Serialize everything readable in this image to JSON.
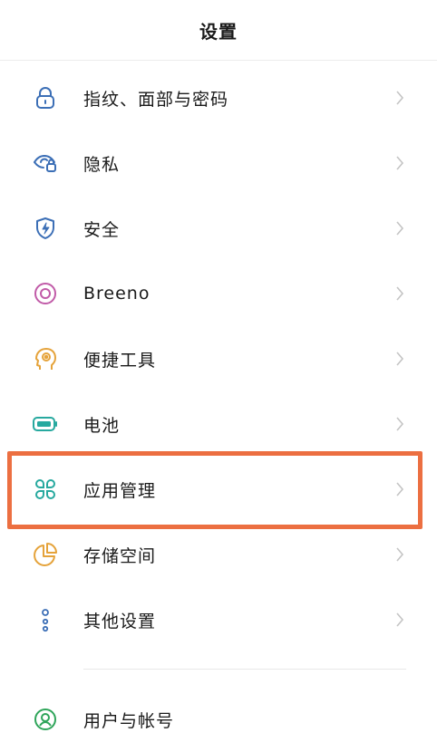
{
  "header": {
    "title": "设置"
  },
  "items": [
    {
      "label": "指纹、面部与密码",
      "icon": "lock-icon",
      "color": "#3c6fb6"
    },
    {
      "label": "隐私",
      "icon": "privacy-eye-icon",
      "color": "#3c6fb6"
    },
    {
      "label": "安全",
      "icon": "shield-icon",
      "color": "#3c6fb6"
    },
    {
      "label": "Breeno",
      "icon": "breeno-icon",
      "color": "#c15ba8"
    },
    {
      "label": "便捷工具",
      "icon": "head-gear-icon",
      "color": "#e5a33b"
    },
    {
      "label": "电池",
      "icon": "battery-icon",
      "color": "#27a99f"
    },
    {
      "label": "应用管理",
      "icon": "apps-grid-icon",
      "color": "#27a99f"
    },
    {
      "label": "存储空间",
      "icon": "pie-chart-icon",
      "color": "#e5a33b"
    },
    {
      "label": "其他设置",
      "icon": "more-dots-icon",
      "color": "#3c6fb6"
    },
    {
      "label": "用户与帐号",
      "icon": "user-icon",
      "color": "#2fa55a"
    }
  ],
  "highlight_color": "#ec6f41"
}
